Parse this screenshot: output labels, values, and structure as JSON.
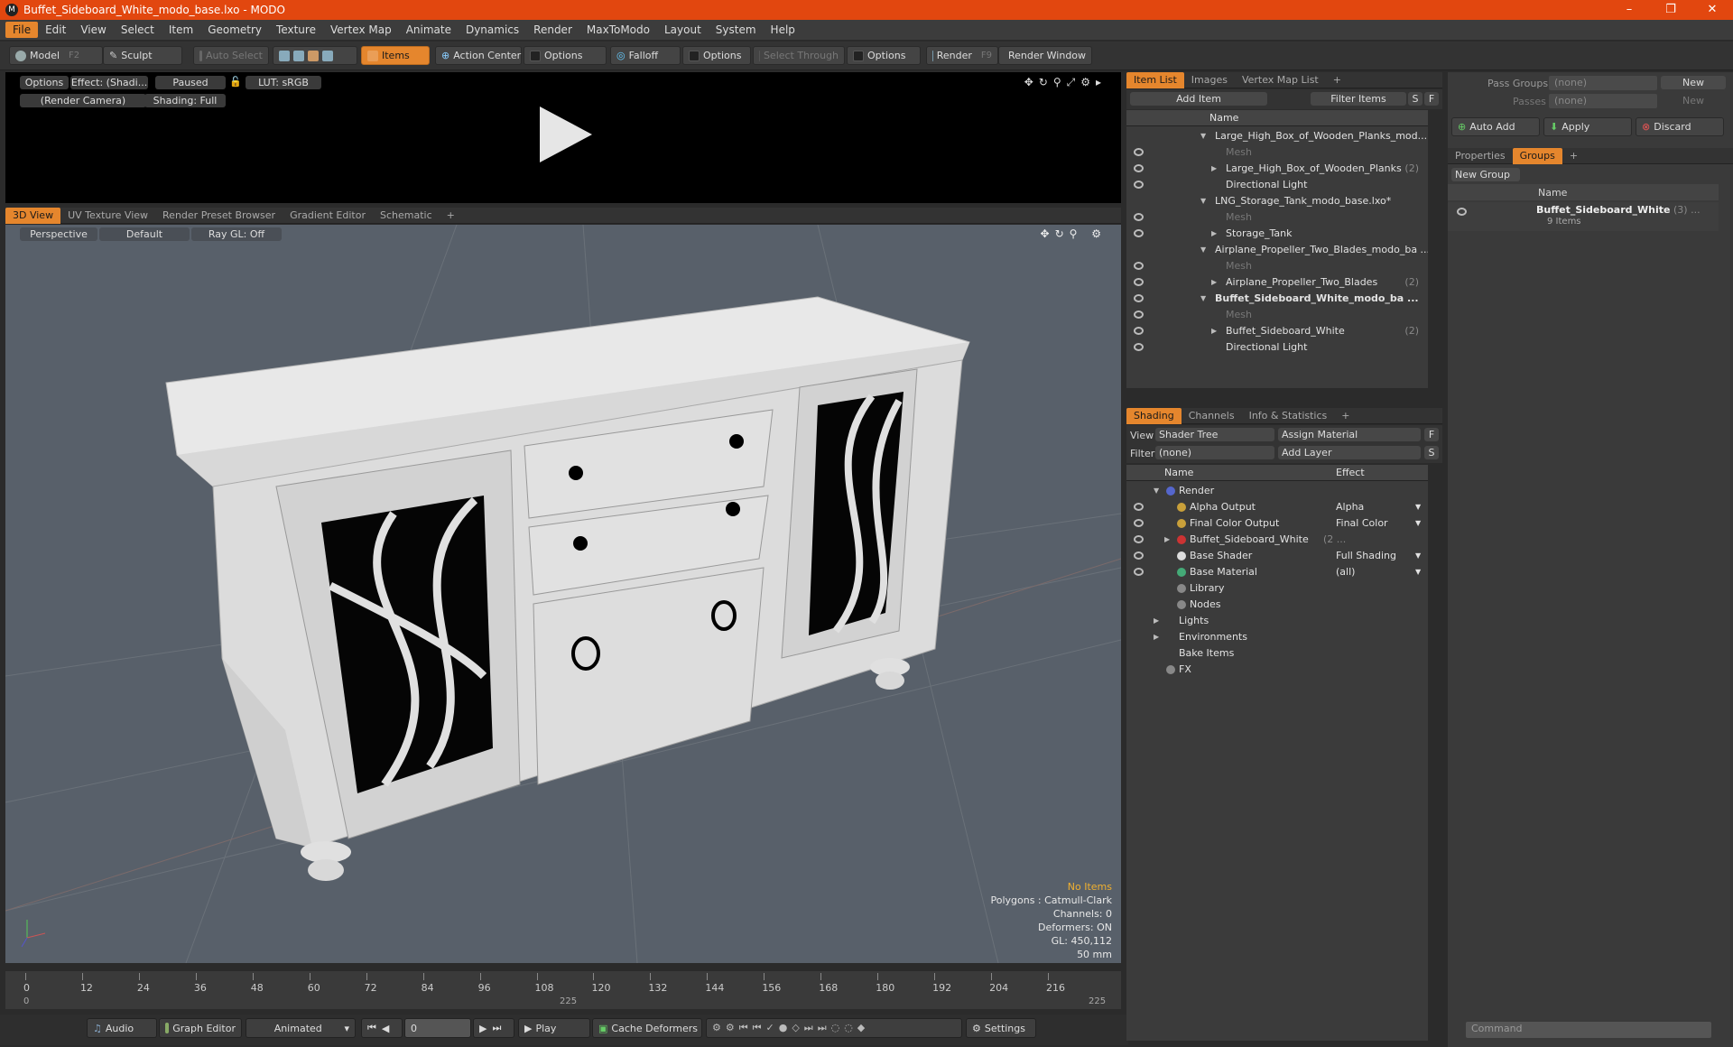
{
  "window": {
    "title": "Buffet_Sideboard_White_modo_base.lxo - MODO",
    "app_icon": "M"
  },
  "menu": [
    "File",
    "Edit",
    "View",
    "Select",
    "Item",
    "Geometry",
    "Texture",
    "Vertex Map",
    "Animate",
    "Dynamics",
    "Render",
    "MaxToModo",
    "Layout",
    "System",
    "Help"
  ],
  "toolbar": {
    "model": "Model",
    "model_key": "F2",
    "sculpt": "Sculpt",
    "auto_select": "Auto Select",
    "items": "Items",
    "action_center": "Action Center",
    "options1": "Options",
    "falloff": "Falloff",
    "options2": "Options",
    "select_through": "Select Through",
    "options3": "Options",
    "render": "Render",
    "render_key": "F9",
    "render_window": "Render Window"
  },
  "preview": {
    "options": "Options",
    "effect": "Effect: (Shadi...",
    "paused": "Paused",
    "lut": "LUT: sRGB",
    "camera": "(Render Camera)",
    "shading": "Shading: Full"
  },
  "viewport_tabs": [
    "3D View",
    "UV Texture View",
    "Render Preset Browser",
    "Gradient Editor",
    "Schematic"
  ],
  "viewport_opts": {
    "projection": "Perspective",
    "style": "Default",
    "raygl": "Ray GL: Off"
  },
  "viewport_info": [
    "No Items",
    "Polygons : Catmull-Clark",
    "Channels: 0",
    "Deformers: ON",
    "GL: 450,112",
    "50 mm"
  ],
  "timeline": {
    "ticks": [
      "0",
      "12",
      "24",
      "36",
      "48",
      "60",
      "72",
      "84",
      "96",
      "108",
      "120",
      "132",
      "144",
      "156",
      "168",
      "180",
      "192",
      "204",
      "216"
    ],
    "lower": [
      "0",
      "225",
      "225"
    ]
  },
  "bottom": {
    "audio": "Audio",
    "graph_editor": "Graph Editor",
    "animated": "Animated",
    "frame": "0",
    "play": "Play",
    "cache": "Cache Deformers",
    "settings": "Settings"
  },
  "itemlist": {
    "tabs": [
      "Item List",
      "Images",
      "Vertex Map List"
    ],
    "add_item": "Add Item",
    "filter": "Filter Items",
    "s": "S",
    "f": "F",
    "col_name": "Name",
    "rows": [
      {
        "label": "Large_High_Box_of_Wooden_Planks_mod...",
        "indent": 0,
        "tri": "▼",
        "dim": false,
        "bold": false,
        "eye": false
      },
      {
        "label": "Mesh",
        "indent": 1,
        "tri": "",
        "dim": true,
        "bold": false,
        "eye": true
      },
      {
        "label": "Large_High_Box_of_Wooden_Planks",
        "count": "(2)",
        "indent": 1,
        "tri": "▶",
        "dim": false,
        "bold": false,
        "eye": true
      },
      {
        "label": "Directional Light",
        "indent": 1,
        "tri": "",
        "dim": false,
        "bold": false,
        "eye": true
      },
      {
        "label": "LNG_Storage_Tank_modo_base.lxo*",
        "indent": 0,
        "tri": "▼",
        "dim": false,
        "bold": false,
        "eye": false
      },
      {
        "label": "Mesh",
        "indent": 1,
        "tri": "",
        "dim": true,
        "bold": false,
        "eye": true
      },
      {
        "label": "Storage_Tank",
        "indent": 1,
        "tri": "▶",
        "dim": false,
        "bold": false,
        "eye": true
      },
      {
        "label": "Airplane_Propeller_Two_Blades_modo_ba ...",
        "indent": 0,
        "tri": "▼",
        "dim": false,
        "bold": false,
        "eye": false
      },
      {
        "label": "Mesh",
        "indent": 1,
        "tri": "",
        "dim": true,
        "bold": false,
        "eye": true
      },
      {
        "label": "Airplane_Propeller_Two_Blades",
        "count": "(2)",
        "indent": 1,
        "tri": "▶",
        "dim": false,
        "bold": false,
        "eye": true
      },
      {
        "label": "Buffet_Sideboard_White_modo_ba ...",
        "indent": 0,
        "tri": "▼",
        "dim": false,
        "bold": true,
        "eye": true
      },
      {
        "label": "Mesh",
        "indent": 1,
        "tri": "",
        "dim": true,
        "bold": false,
        "eye": true
      },
      {
        "label": "Buffet_Sideboard_White",
        "count": "(2)",
        "indent": 1,
        "tri": "▶",
        "dim": false,
        "bold": false,
        "eye": true
      },
      {
        "label": "Directional Light",
        "indent": 1,
        "tri": "",
        "dim": false,
        "bold": false,
        "eye": true
      }
    ]
  },
  "shading": {
    "tabs": [
      "Shading",
      "Channels",
      "Info & Statistics"
    ],
    "view_label": "View",
    "view_value": "Shader Tree",
    "assign": "Assign Material",
    "f": "F",
    "filter_label": "Filter",
    "filter_value": "(none)",
    "add_layer": "Add Layer",
    "s": "S",
    "col_name": "Name",
    "col_effect": "Effect",
    "rows": [
      {
        "label": "Render",
        "effect": "",
        "indent": 0,
        "tri": "▼",
        "eye": false,
        "icon": "#5566cc"
      },
      {
        "label": "Alpha Output",
        "effect": "Alpha",
        "indent": 1,
        "tri": "",
        "eye": true,
        "icon": "#c9a03a"
      },
      {
        "label": "Final Color Output",
        "effect": "Final Color",
        "indent": 1,
        "tri": "",
        "eye": true,
        "icon": "#c9a03a"
      },
      {
        "label": "Buffet_Sideboard_White",
        "count": "(2 ...",
        "effect": "",
        "indent": 1,
        "tri": "▶",
        "eye": true,
        "icon": "#cc3333"
      },
      {
        "label": "Base Shader",
        "effect": "Full Shading",
        "indent": 1,
        "tri": "",
        "eye": true,
        "icon": "#dddddd"
      },
      {
        "label": "Base Material",
        "effect": "(all)",
        "indent": 1,
        "tri": "",
        "eye": true,
        "icon": "#44aa77"
      },
      {
        "label": "Library",
        "effect": "",
        "indent": 1,
        "tri": "",
        "eye": false,
        "icon": "#888888"
      },
      {
        "label": "Nodes",
        "effect": "",
        "indent": 1,
        "tri": "",
        "eye": false,
        "icon": "#888888"
      },
      {
        "label": "Lights",
        "effect": "",
        "indent": 0,
        "tri": "▶",
        "eye": false,
        "icon": ""
      },
      {
        "label": "Environments",
        "effect": "",
        "indent": 0,
        "tri": "▶",
        "eye": false,
        "icon": ""
      },
      {
        "label": "Bake Items",
        "effect": "",
        "indent": 0,
        "tri": "",
        "eye": false,
        "icon": ""
      },
      {
        "label": "FX",
        "effect": "",
        "indent": 0,
        "tri": "",
        "eye": false,
        "icon": "#888888"
      }
    ]
  },
  "passes": {
    "pass_groups": "Pass Groups",
    "pass_value": "(none)",
    "new": "New",
    "passes": "Passes",
    "passes_value": "(none)",
    "new2": "New",
    "auto_add": "Auto Add",
    "apply": "Apply",
    "discard": "Discard"
  },
  "groups": {
    "tabs": [
      "Properties",
      "Groups"
    ],
    "new_group": "New Group",
    "col_name": "Name",
    "group_name": "Buffet_Sideboard_White",
    "group_count": "(3) ...",
    "group_items": "9 Items"
  },
  "command": {
    "placeholder": "Command"
  },
  "colors": {
    "accent": "#e5862d",
    "title_bar": "#e2470f",
    "viewport": "#58606a"
  }
}
